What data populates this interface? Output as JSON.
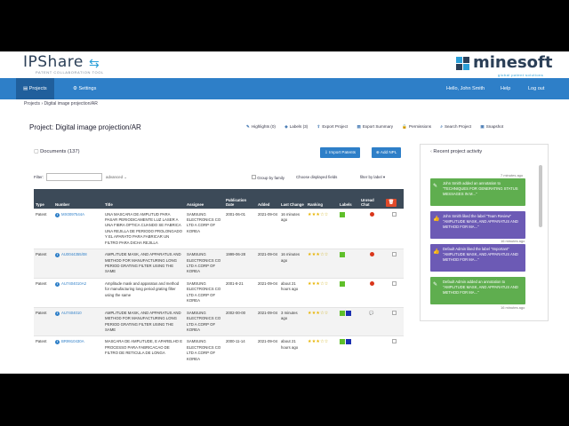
{
  "brand": {
    "ipshare": "IPShare",
    "ipshare_tagline": "PATENT COLLABORATION TOOL",
    "minesoft": "minesoft",
    "minesoft_tagline": "global patent solutions",
    "colors": {
      "nav": "#2e7fc8",
      "nav_active": "#205f9c",
      "accent": "#2a9fd8"
    }
  },
  "nav": {
    "projects": "Projects",
    "settings": "Settings",
    "greeting": "Hello, John Smith",
    "help": "Help",
    "logout": "Log out"
  },
  "breadcrumb": "Projects  ›  Digital image projection/AR",
  "project_title": "Project: Digital image projection/AR",
  "toolbar": {
    "highlights": "Highlights (0)",
    "labels": "Labels (3)",
    "export_project": "Export Project",
    "export_summary": "Export Summary",
    "permissions": "Permissions",
    "search_project": "Search Project",
    "snapshot": "Snapshot"
  },
  "documents": {
    "heading": "Documents (137)",
    "import_button": "Import Patents",
    "add_npl_button": "Add NPL",
    "filter_label": "Filter:",
    "advanced": "advanced",
    "group_by_family": "Group by family",
    "choose_fields": "Choose displayed fields",
    "filter_by_label": "filter by label"
  },
  "table": {
    "headers": [
      "Type",
      "Number",
      "Title",
      "Assignee",
      "Publication Date",
      "Added",
      "Last Change",
      "Ranking",
      "Labels",
      "Unread Chat"
    ],
    "rows": [
      {
        "type": "Patent",
        "number": "MX0097544A",
        "title": "UNA MASCARA DE AMPLITUD PARA PASAR PERIODICAMENTE LUZ LASER A UNA FIBRA OPTICA CUANDO SE FABRICA UNA REJILLA DE PERIODO PROLONGADO Y EL APARATO PARA FABRICAR UN FILTRO PARA DICHA REJILLA",
        "assignee": "SAMSUNG ELECTRONICS CO LTD A CORP OF KOREA",
        "pub_date": "2001-06-01",
        "added": "2021-09-04",
        "last_change": "16 minutes ago",
        "stars": 3,
        "labels": [
          "#5fbf2a"
        ],
        "chat": "red"
      },
      {
        "type": "Patent",
        "number": "AU0044355/08",
        "title": "AMPLITUDE MASK, AND APPARATUS AND METHOD FOR MANUFACTURING LONG PERIOD GRATING FILTER USING THE SAME",
        "assignee": "SAMSUNG ELECTRONICS CO LTD A CORP OF KOREA",
        "pub_date": "1999-06-28",
        "added": "2021-09-04",
        "last_change": "16 minutes ago",
        "stars": 3,
        "labels": [
          "#5fbf2a"
        ],
        "chat": "red"
      },
      {
        "type": "Patent",
        "number": "AU7404010A2",
        "title": "Amplitude mask and apparatus and method for manufacturing long period grating filter using the same",
        "assignee": "SAMSUNG ELECTRONICS CO LTD A CORP OF KOREA",
        "pub_date": "2001-8-21",
        "added": "2021-09-04",
        "last_change": "about 21 hours ago",
        "stars": 3,
        "labels": [
          "#5fbf2a"
        ],
        "chat": "red"
      },
      {
        "type": "Patent",
        "number": "AU7404010",
        "title": "AMPLITUDE MASK, AND APPARATUS AND METHOD FOR MANUFACTURING LONG PERIOD GRATING FILTER USING THE SAME",
        "assignee": "SAMSUNG ELECTRONICS CO LTD A CORP OF KOREA",
        "pub_date": "2002-00-00",
        "added": "2021-09-04",
        "last_change": "3 minutes ago",
        "stars": 3,
        "labels": [
          "#5fbf2a",
          "#1b2fb0"
        ],
        "chat": "comment"
      },
      {
        "type": "Patent",
        "number": "BR9910430A",
        "title": "MASCARA DE AMPLITUDE, E APARELHO E PROCESSO PARA FABRICACAO DE FILTRO DE RETICULA DE LONGA",
        "assignee": "SAMSUNG ELECTRONICS CO LTD A CORP OF KOREA",
        "pub_date": "2000-11-14",
        "added": "2021-09-04",
        "last_change": "about 21 hours ago",
        "stars": 3,
        "labels": [
          "#5fbf2a",
          "#1b2fb0"
        ],
        "chat": "none"
      }
    ]
  },
  "activity": {
    "heading": "Recent project activity",
    "items": [
      {
        "time": "7 minutes ago",
        "text": "John Smith added an annotation to \"TECHNIQUES FOR GENERATING STATUS MESSAGES IN M...\"",
        "kind": "annotation",
        "color": "#5fae4f"
      },
      {
        "time": "",
        "text": "John Smith liked the label \"Team Review\" \"AMPLITUDE MASK, AND APPARATUS AND METHOD FOR MA...\"",
        "kind": "like",
        "color": "#6c5ab5"
      },
      {
        "time": "16 minutes ago",
        "text": "Default Admin liked the label \"Important\" \"AMPLITUDE MASK, AND APPARATUS AND METHOD FOR MA...\"",
        "kind": "like",
        "color": "#6c5ab5"
      },
      {
        "time": "",
        "text": "Default Admin added an annotation to \"AMPLITUDE MASK, AND APPARATUS AND METHOD FOR MA...\"",
        "kind": "annotation",
        "color": "#5fae4f"
      },
      {
        "time": "16 minutes ago",
        "text": "",
        "kind": "",
        "color": ""
      }
    ]
  }
}
